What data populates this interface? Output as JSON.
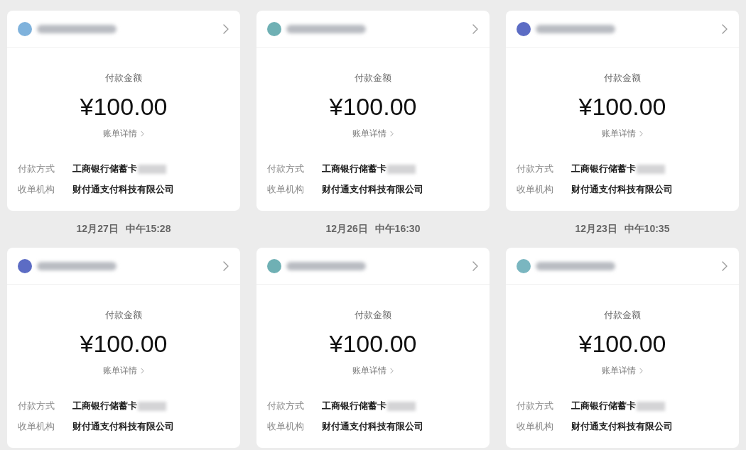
{
  "cards": [
    {
      "color": "#7fb2dc",
      "name_masked": true,
      "amount_label": "付款金额",
      "amount": "¥100.00",
      "details_link": "账单详情",
      "fields": [
        {
          "label": "付款方式",
          "value": "工商银行储蓄卡",
          "masked": true
        },
        {
          "label": "收单机构",
          "value": "财付通支付科技有限公司",
          "masked": false
        }
      ]
    },
    {
      "color": "#6fb0b4",
      "name_masked": true,
      "amount_label": "付款金额",
      "amount": "¥100.00",
      "details_link": "账单详情",
      "fields": [
        {
          "label": "付款方式",
          "value": "工商银行储蓄卡",
          "masked": true
        },
        {
          "label": "收单机构",
          "value": "财付通支付科技有限公司",
          "masked": false
        }
      ]
    },
    {
      "color": "#5c6cc4",
      "name_masked": true,
      "amount_label": "付款金额",
      "amount": "¥100.00",
      "details_link": "账单详情",
      "fields": [
        {
          "label": "付款方式",
          "value": "工商银行储蓄卡",
          "masked": true
        },
        {
          "label": "收单机构",
          "value": "财付通支付科技有限公司",
          "masked": false
        }
      ]
    },
    {
      "timestamp": "12月27日 中午15:28",
      "color": "#5c6cc4",
      "name_masked": true,
      "amount_label": "付款金额",
      "amount": "¥100.00",
      "details_link": "账单详情",
      "fields": [
        {
          "label": "付款方式",
          "value": "工商银行储蓄卡",
          "masked": true
        },
        {
          "label": "收单机构",
          "value": "财付通支付科技有限公司",
          "masked": false
        }
      ]
    },
    {
      "timestamp": "12月26日 中午16:30",
      "color": "#6fb0b4",
      "name_masked": true,
      "amount_label": "付款金额",
      "amount": "¥100.00",
      "details_link": "账单详情",
      "fields": [
        {
          "label": "付款方式",
          "value": "工商银行储蓄卡",
          "masked": true
        },
        {
          "label": "收单机构",
          "value": "财付通支付科技有限公司",
          "masked": false
        }
      ]
    },
    {
      "timestamp": "12月23日 中午10:35",
      "color": "#7ab6c0",
      "name_masked": true,
      "amount_label": "付款金额",
      "amount": "¥100.00",
      "details_link": "账单详情",
      "fields": [
        {
          "label": "付款方式",
          "value": "工商银行储蓄卡",
          "masked": true
        },
        {
          "label": "收单机构",
          "value": "财付通支付科技有限公司",
          "masked": false
        }
      ]
    }
  ]
}
